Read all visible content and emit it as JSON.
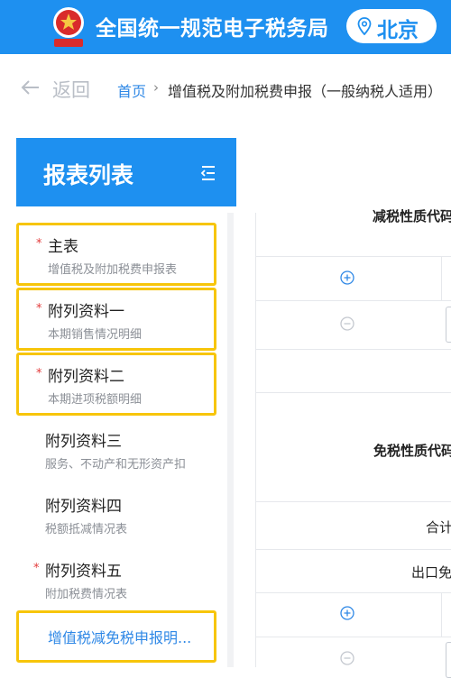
{
  "header": {
    "title": "全国统一规范电子税务局",
    "region": "北京",
    "logo_icon": "tax-bureau-emblem",
    "brand_color": "#1e90f0"
  },
  "breadcrumb": {
    "back_label": "返回",
    "home": "首页",
    "separator": "›",
    "current": "增值税及附加税费申报（一般纳税人适用）"
  },
  "sidebar": {
    "title": "报表列表",
    "items": [
      {
        "required": true,
        "title": "主表",
        "subtitle": "增值税及附加税费申报表",
        "highlighted": true
      },
      {
        "required": true,
        "title": "附列资料一",
        "subtitle": "本期销售情况明细",
        "highlighted": true
      },
      {
        "required": true,
        "title": "附列资料二",
        "subtitle": "本期进项税额明细",
        "highlighted": true
      },
      {
        "required": false,
        "title": "附列资料三",
        "subtitle": "服务、不动产和无形资产扣",
        "highlighted": false
      },
      {
        "required": false,
        "title": "附列资料四",
        "subtitle": "税额抵减情况表",
        "highlighted": false
      },
      {
        "required": true,
        "title": "附列资料五",
        "subtitle": "附加税费情况表",
        "highlighted": false
      }
    ],
    "link_item": {
      "label": "增值税减免税申报明...",
      "highlighted": true
    },
    "required_mark": "*"
  },
  "table": {
    "section1_heading": "减税性质代码",
    "section2_heading": "免税性质代码",
    "total_label": "合计",
    "export_label": "出口免"
  },
  "colors": {
    "highlight_border": "#f7c50a",
    "required_star": "#e23b3b",
    "link": "#2f88e6"
  }
}
